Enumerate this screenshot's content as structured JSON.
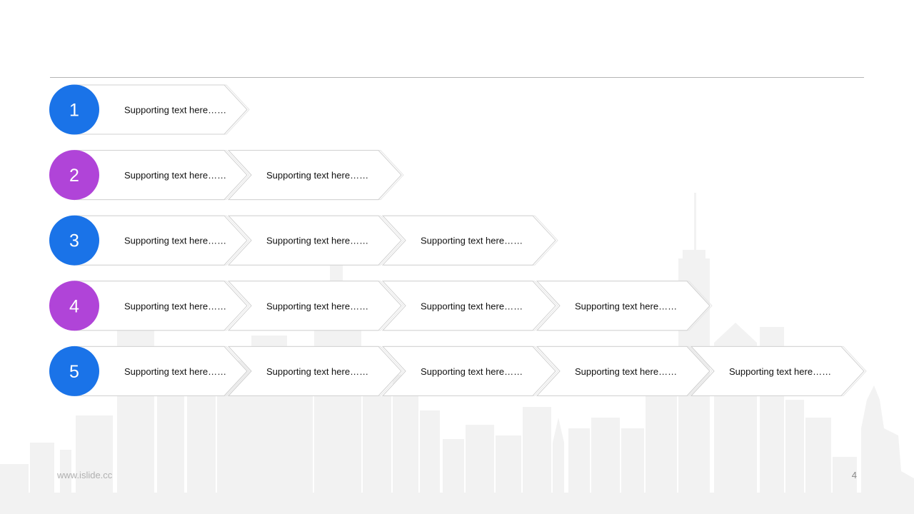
{
  "rows": [
    {
      "number": "1",
      "color": "#1a73e8",
      "items": [
        "Supporting text here……"
      ]
    },
    {
      "number": "2",
      "color": "#b044d8",
      "items": [
        "Supporting text here……",
        "Supporting text here……"
      ]
    },
    {
      "number": "3",
      "color": "#1a73e8",
      "items": [
        "Supporting text here……",
        "Supporting text here……",
        "Supporting text here……"
      ]
    },
    {
      "number": "4",
      "color": "#b044d8",
      "items": [
        "Supporting text here……",
        "Supporting text here……",
        "Supporting text here……",
        "Supporting text here……"
      ]
    },
    {
      "number": "5",
      "color": "#1a73e8",
      "items": [
        "Supporting text here……",
        "Supporting text here……",
        "Supporting text here……",
        "Supporting text here……",
        "Supporting text here……"
      ]
    }
  ],
  "footer": {
    "url": "www.islide.cc",
    "page_number": "4"
  },
  "colors": {
    "blue": "#1a73e8",
    "purple": "#b044d8",
    "skyline": "#f1f1f1",
    "chevron_border": "#d0d0d0"
  }
}
